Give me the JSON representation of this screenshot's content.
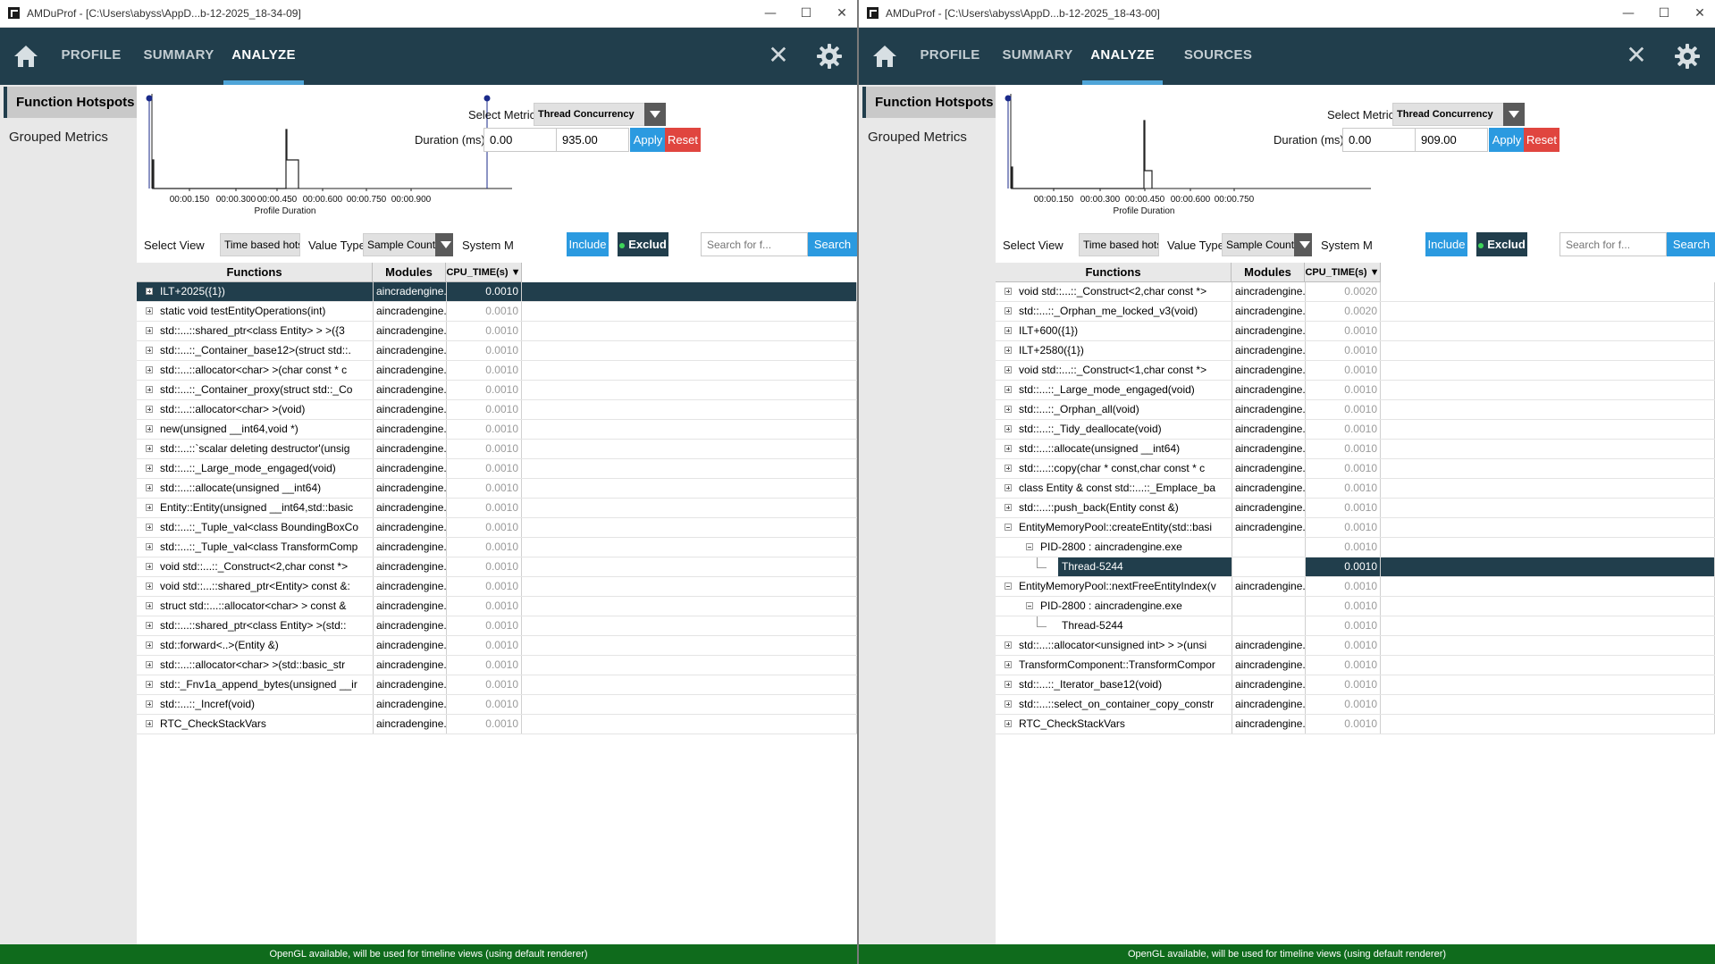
{
  "windows": [
    {
      "id": "left",
      "title": "AMDuProf - [C:\\Users\\abyss\\AppD...b-12-2025_18-34-09]",
      "nav_tabs": [
        "PROFILE",
        "SUMMARY",
        "ANALYZE"
      ],
      "active_tab": "ANALYZE",
      "sidebar": {
        "active": "Function Hotspots",
        "item": "Grouped Metrics"
      },
      "chart": {
        "tick_labels": [
          "00:00.150",
          "00:00.300",
          "00:00.450",
          "00:00.600",
          "00:00.750",
          "00:00.900"
        ],
        "xlabel": "Profile Duration"
      },
      "controls": {
        "select_metric_label": "Select Metric",
        "metric_value": "Thread Concurrency",
        "duration_label": "Duration (ms)",
        "duration_start": "0.00",
        "duration_end": "935.00",
        "apply": "Apply",
        "reset": "Reset",
        "select_view_label": "Select View",
        "view_value": "Time based hotspo",
        "value_type_label": "Value Type",
        "value_type_value": "Sample Count",
        "system_label": "System M",
        "include": "Include",
        "exclude": "Exclud",
        "search_placeholder": "Search for f...",
        "search_button": "Search"
      },
      "table": {
        "headers": [
          "Functions",
          "Modules",
          "CPU_TIME(s) ▼"
        ],
        "rows": [
          {
            "fn": "ILT+2025({1})",
            "mod": "aincradengine.ex",
            "cpu": "0.0010",
            "expand": "plus",
            "selected": true
          },
          {
            "fn": "static void testEntityOperations(int)",
            "mod": "aincradengine.ex",
            "cpu": "0.0010",
            "expand": "plus"
          },
          {
            "fn": "std::...::shared_ptr<class Entity> > >({3",
            "mod": "aincradengine.ex",
            "cpu": "0.0010",
            "expand": "plus"
          },
          {
            "fn": "std::...::_Container_base12>(struct std::.",
            "mod": "aincradengine.ex",
            "cpu": "0.0010",
            "expand": "plus"
          },
          {
            "fn": "std::...::allocator<char> >(char const * c",
            "mod": "aincradengine.ex",
            "cpu": "0.0010",
            "expand": "plus"
          },
          {
            "fn": "std::...::_Container_proxy(struct std::_Co",
            "mod": "aincradengine.ex",
            "cpu": "0.0010",
            "expand": "plus"
          },
          {
            "fn": "std::...::allocator<char> >(void)",
            "mod": "aincradengine.ex",
            "cpu": "0.0010",
            "expand": "plus"
          },
          {
            "fn": "new(unsigned __int64,void *)",
            "mod": "aincradengine.ex",
            "cpu": "0.0010",
            "expand": "plus"
          },
          {
            "fn": "std::...::`scalar deleting destructor'(unsig",
            "mod": "aincradengine.ex",
            "cpu": "0.0010",
            "expand": "plus"
          },
          {
            "fn": "std::...::_Large_mode_engaged(void)",
            "mod": "aincradengine.ex",
            "cpu": "0.0010",
            "expand": "plus"
          },
          {
            "fn": "std::...::allocate(unsigned __int64)",
            "mod": "aincradengine.ex",
            "cpu": "0.0010",
            "expand": "plus"
          },
          {
            "fn": "Entity::Entity(unsigned __int64,std::basic",
            "mod": "aincradengine.ex",
            "cpu": "0.0010",
            "expand": "plus"
          },
          {
            "fn": "std::...::_Tuple_val<class BoundingBoxCo",
            "mod": "aincradengine.ex",
            "cpu": "0.0010",
            "expand": "plus"
          },
          {
            "fn": "std::...::_Tuple_val<class TransformComp",
            "mod": "aincradengine.ex",
            "cpu": "0.0010",
            "expand": "plus"
          },
          {
            "fn": "void std::...::_Construct<2,char const *>",
            "mod": "aincradengine.ex",
            "cpu": "0.0010",
            "expand": "plus"
          },
          {
            "fn": "void std::...::shared_ptr<Entity> const &:",
            "mod": "aincradengine.ex",
            "cpu": "0.0010",
            "expand": "plus"
          },
          {
            "fn": "struct std::...::allocator<char> > const &",
            "mod": "aincradengine.ex",
            "cpu": "0.0010",
            "expand": "plus"
          },
          {
            "fn": "std::...::shared_ptr<class Entity> >(std::",
            "mod": "aincradengine.ex",
            "cpu": "0.0010",
            "expand": "plus"
          },
          {
            "fn": "std::forward<..>(Entity &)",
            "mod": "aincradengine.ex",
            "cpu": "0.0010",
            "expand": "plus"
          },
          {
            "fn": "std::...::allocator<char> >(std::basic_str",
            "mod": "aincradengine.ex",
            "cpu": "0.0010",
            "expand": "plus"
          },
          {
            "fn": "std::_Fnv1a_append_bytes(unsigned __ir",
            "mod": "aincradengine.ex",
            "cpu": "0.0010",
            "expand": "plus"
          },
          {
            "fn": "std::...::_Incref(void)",
            "mod": "aincradengine.ex",
            "cpu": "0.0010",
            "expand": "plus"
          },
          {
            "fn": "RTC_CheckStackVars",
            "mod": "aincradengine.ex",
            "cpu": "0.0010",
            "expand": "plus"
          }
        ]
      },
      "status": "OpenGL available, will be used for timeline views (using default renderer)"
    },
    {
      "id": "right",
      "title": "AMDuProf - [C:\\Users\\abyss\\AppD...b-12-2025_18-43-00]",
      "nav_tabs": [
        "PROFILE",
        "SUMMARY",
        "ANALYZE",
        "SOURCES"
      ],
      "active_tab": "ANALYZE",
      "sidebar": {
        "active": "Function Hotspots",
        "item": "Grouped Metrics"
      },
      "chart": {
        "tick_labels": [
          "00:00.150",
          "00:00.300",
          "00:00.450",
          "00:00.600",
          "00:00.750"
        ],
        "xlabel": "Profile Duration"
      },
      "controls": {
        "select_metric_label": "Select Metric",
        "metric_value": "Thread Concurrency",
        "duration_label": "Duration (ms)",
        "duration_start": "0.00",
        "duration_end": "909.00",
        "apply": "Apply",
        "reset": "Reset",
        "select_view_label": "Select View",
        "view_value": "Time based hotspo",
        "value_type_label": "Value Type",
        "value_type_value": "Sample Count",
        "system_label": "System M",
        "include": "Include",
        "exclude": "Exclud",
        "search_placeholder": "Search for f...",
        "search_button": "Search"
      },
      "table": {
        "headers": [
          "Functions",
          "Modules",
          "CPU_TIME(s) ▼"
        ],
        "rows": [
          {
            "fn": "void std::...::_Construct<2,char const *>",
            "mod": "aincradengine.ex",
            "cpu": "0.0020",
            "expand": "plus"
          },
          {
            "fn": "std::...::_Orphan_me_locked_v3(void)",
            "mod": "aincradengine.ex",
            "cpu": "0.0020",
            "expand": "plus"
          },
          {
            "fn": "ILT+600({1})",
            "mod": "aincradengine.ex",
            "cpu": "0.0010",
            "expand": "plus"
          },
          {
            "fn": "ILT+2580({1})",
            "mod": "aincradengine.ex",
            "cpu": "0.0010",
            "expand": "plus"
          },
          {
            "fn": "void std::...::_Construct<1,char const *>",
            "mod": "aincradengine.ex",
            "cpu": "0.0010",
            "expand": "plus"
          },
          {
            "fn": "std::...::_Large_mode_engaged(void)",
            "mod": "aincradengine.ex",
            "cpu": "0.0010",
            "expand": "plus"
          },
          {
            "fn": "std::...::_Orphan_all(void)",
            "mod": "aincradengine.ex",
            "cpu": "0.0010",
            "expand": "plus"
          },
          {
            "fn": "std::...::_Tidy_deallocate(void)",
            "mod": "aincradengine.ex",
            "cpu": "0.0010",
            "expand": "plus"
          },
          {
            "fn": "std::...::allocate(unsigned __int64)",
            "mod": "aincradengine.ex",
            "cpu": "0.0010",
            "expand": "plus"
          },
          {
            "fn": "std::...::copy(char * const,char const * c",
            "mod": "aincradengine.ex",
            "cpu": "0.0010",
            "expand": "plus"
          },
          {
            "fn": "class Entity & const std::...::_Emplace_ba",
            "mod": "aincradengine.ex",
            "cpu": "0.0010",
            "expand": "plus"
          },
          {
            "fn": "std::...::push_back(Entity const &)",
            "mod": "aincradengine.ex",
            "cpu": "0.0010",
            "expand": "plus"
          },
          {
            "fn": "EntityMemoryPool::createEntity(std::basi",
            "mod": "aincradengine.ex",
            "cpu": "0.0010",
            "expand": "minus"
          },
          {
            "fn": "PID-2800 : aincradengine.exe",
            "mod": "",
            "cpu": "0.0010",
            "expand": "minus",
            "level": 1
          },
          {
            "fn": "Thread-5244",
            "mod": "",
            "cpu": "0.0010",
            "expand": "none",
            "level": 2,
            "selfn": true,
            "cpusel": true
          },
          {
            "fn": "EntityMemoryPool::nextFreeEntityIndex(v",
            "mod": "aincradengine.ex",
            "cpu": "0.0010",
            "expand": "minus"
          },
          {
            "fn": "PID-2800 : aincradengine.exe",
            "mod": "",
            "cpu": "0.0010",
            "expand": "minus",
            "level": 1
          },
          {
            "fn": "Thread-5244",
            "mod": "",
            "cpu": "0.0010",
            "expand": "none",
            "level": 2
          },
          {
            "fn": "std::...::allocator<unsigned int> > >(unsi",
            "mod": "aincradengine.ex",
            "cpu": "0.0010",
            "expand": "plus"
          },
          {
            "fn": "TransformComponent::TransformCompor",
            "mod": "aincradengine.ex",
            "cpu": "0.0010",
            "expand": "plus"
          },
          {
            "fn": "std::...::_Iterator_base12(void)",
            "mod": "aincradengine.ex",
            "cpu": "0.0010",
            "expand": "plus"
          },
          {
            "fn": "std::...::select_on_container_copy_constr",
            "mod": "aincradengine.ex",
            "cpu": "0.0010",
            "expand": "plus"
          },
          {
            "fn": "RTC_CheckStackVars",
            "mod": "aincradengine.ex",
            "cpu": "0.0010",
            "expand": "plus"
          }
        ]
      },
      "status": "OpenGL available, will be used for timeline views (using default renderer)"
    }
  ],
  "colors": {
    "navbar": "#213e4c",
    "accent": "#4fa5d8",
    "status": "#0f6b1c",
    "reset": "#e0453f",
    "apply": "#2b9ae0"
  }
}
